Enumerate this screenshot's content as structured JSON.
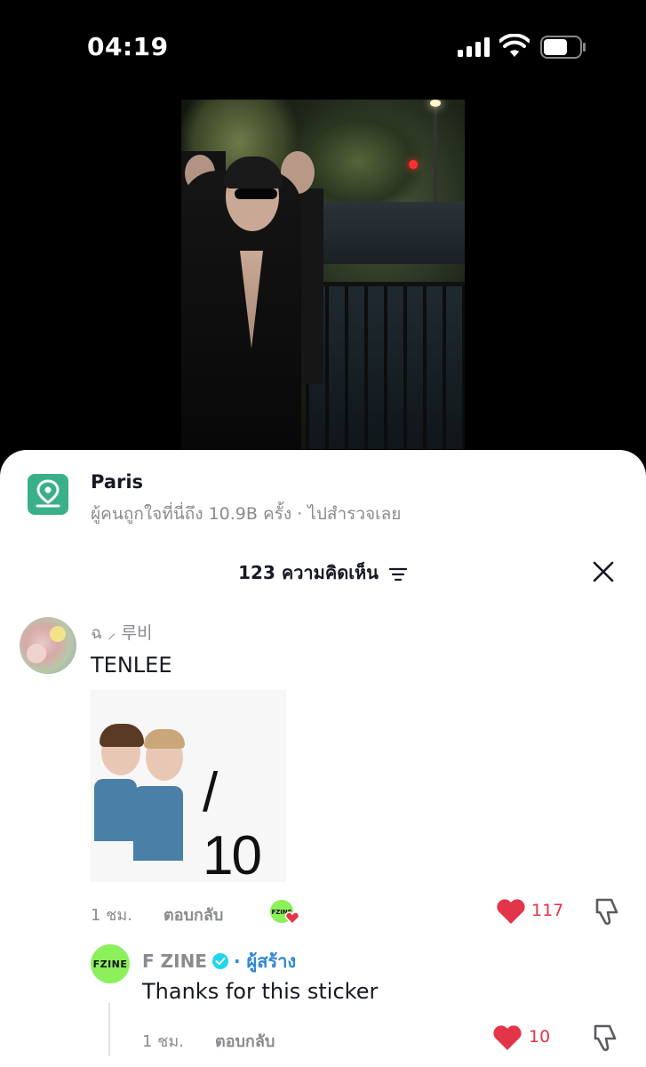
{
  "status_bar": {
    "time": "04:19"
  },
  "location": {
    "title": "Paris",
    "subtitle": "ผู้คนถูกใจที่นี่ถึง 10.9B ครั้ง · ไปสำรวจเลย"
  },
  "comments_header": {
    "label": "123 ความคิดเห็น"
  },
  "comments": [
    {
      "username": "ฉ ⸝ 루비",
      "text": "TENLEE",
      "sticker_score": "/ 10",
      "time": "1 ชม.",
      "reply_label": "ตอบกลับ",
      "likes": "117",
      "creator_badge_text": "FZINE"
    }
  ],
  "reply": {
    "avatar_text": "FZINE",
    "username": "F ZINE",
    "creator_label": "· ผู้สร้าง",
    "text": "Thanks for this sticker",
    "time": "1 ชม.",
    "reply_label": "ตอบกลับ",
    "likes": "10"
  },
  "colors": {
    "like_red": "#e3354a",
    "creator_blue": "#2f87d8",
    "location_green": "#3ab08a",
    "fzine_green": "#8bf05a"
  }
}
